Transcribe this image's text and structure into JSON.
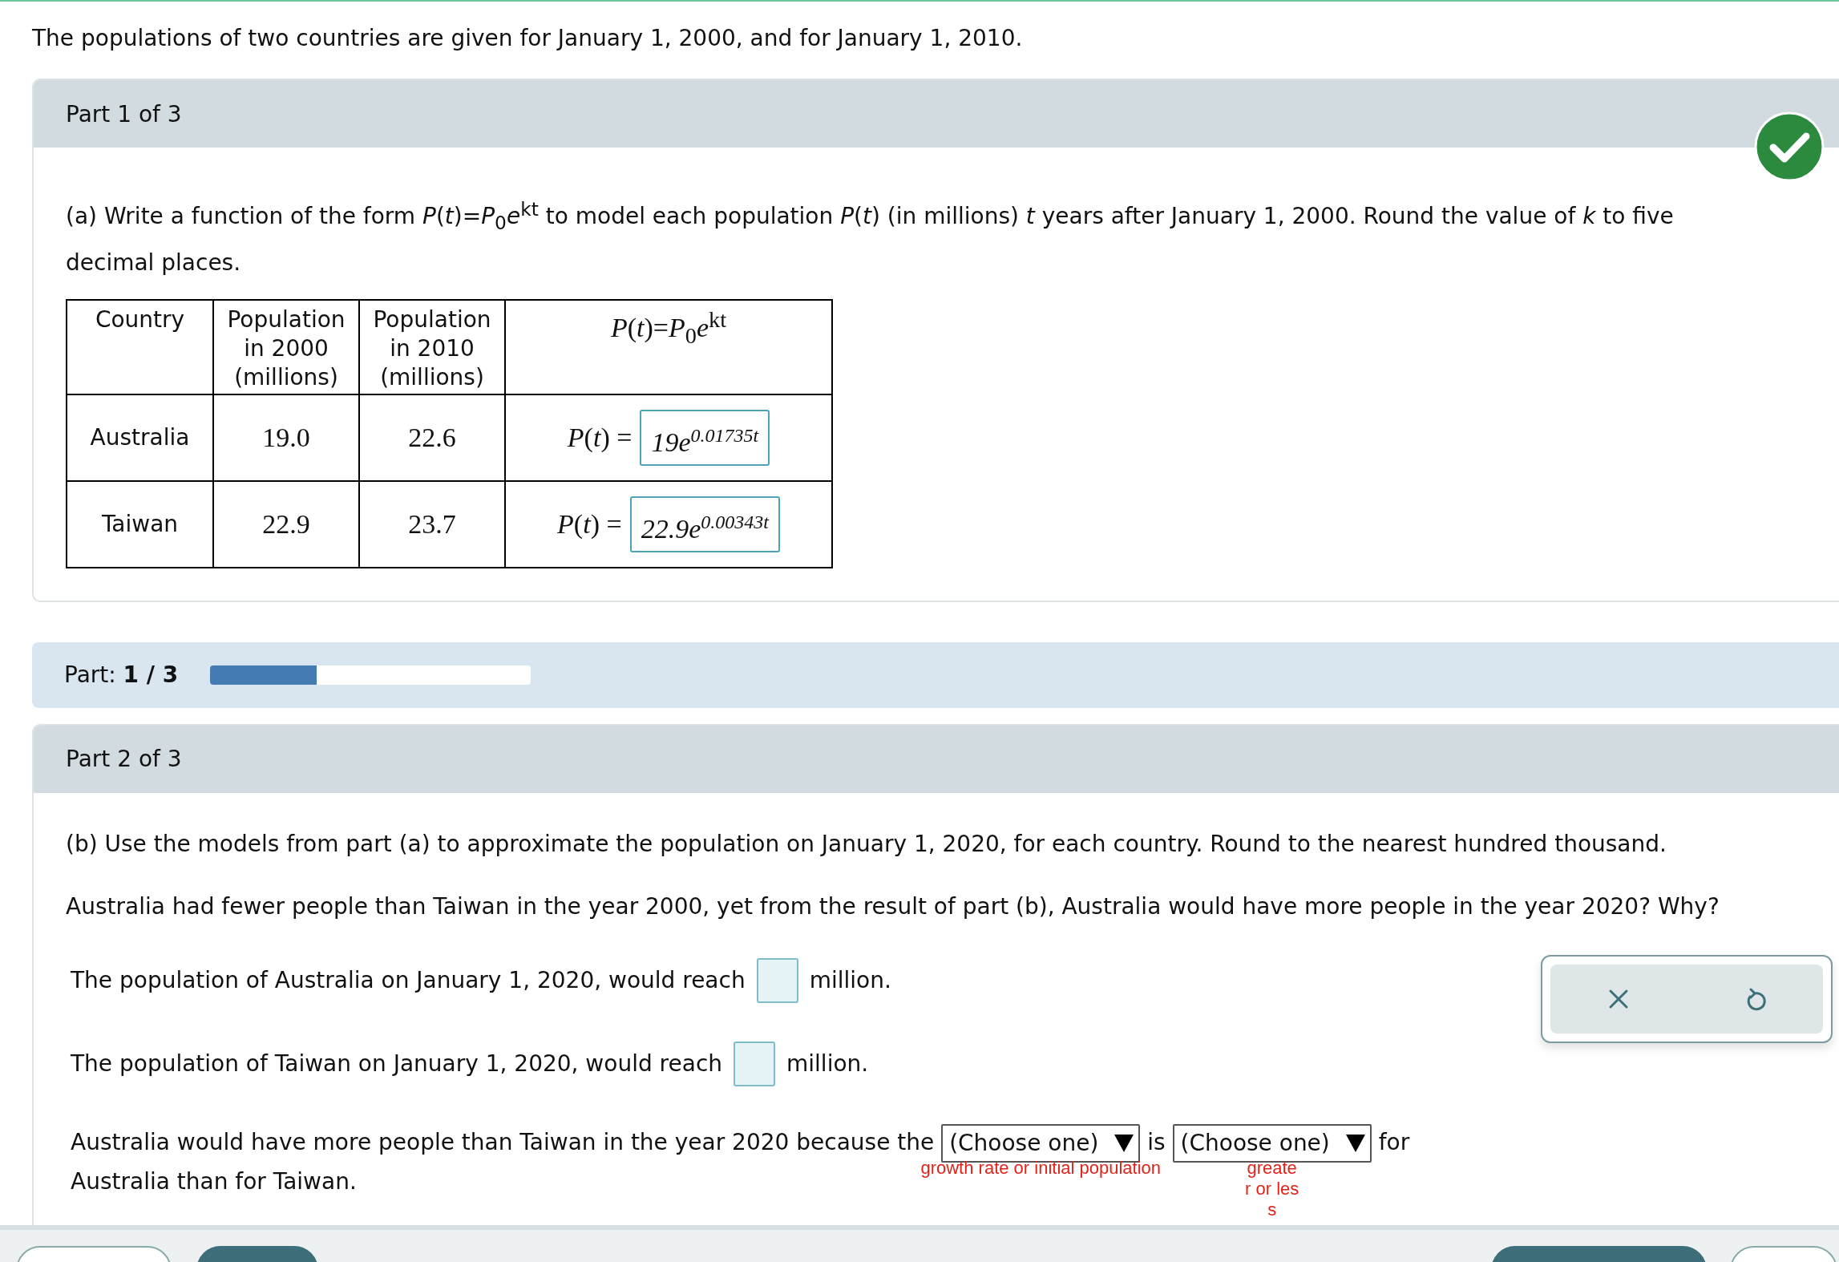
{
  "intro": "The populations of two countries are given for January 1, 2000, and for January 1, 2010.",
  "part1": {
    "header": "Part 1 of 3",
    "correct": true,
    "prompt": "(a) Write a function of the form *P*(*t*)=*P*$_{0}$*e*$^{kt}$ to model each population *P*(*t*) (in millions) *t* years after January 1, 2000. Round the value of *k* to five decimal places.",
    "table": {
      "columns": [
        "Country",
        "Population in 2000 (millions)",
        "Population in 2010 (millions)",
        "*P*(*t*)=*P*$_{0}$*e*$^{kt}$"
      ],
      "rows": [
        {
          "country": "Australia",
          "pop_2000": "19.0",
          "pop_2010": "22.6",
          "lhs": "*P*(*t*) =",
          "answer_base": "19e",
          "answer_exponent": "0.01735t"
        },
        {
          "country": "Taiwan",
          "pop_2000": "22.9",
          "pop_2010": "23.7",
          "lhs": "*P*(*t*) =",
          "answer_base": "22.9e",
          "answer_exponent": "0.00343t"
        }
      ]
    }
  },
  "progress": {
    "label": "Part:",
    "value": "1 / 3",
    "level": 0.333
  },
  "part2": {
    "header": "Part 2 of 3",
    "paragraphs": [
      "(b) Use the models from part (a) to approximate the population on January 1, 2020, for each country. Round to the nearest hundred thousand.",
      "Australia had fewer people than Taiwan in the year 2000, yet from the result of part (b), Australia would have more people in the year 2020? Why?"
    ],
    "answer_lines": [
      {
        "before": "The population of Australia on January 1, 2020, would reach",
        "after": "million."
      },
      {
        "before": "The population of Taiwan on January 1, 2020, would reach",
        "after": "million."
      }
    ],
    "choice_sentence": {
      "before": "Australia would have more people than Taiwan in the year 2020 because the",
      "dropdowns": [
        {
          "value": "(Choose one)",
          "hint": "growth rate or initial population",
          "kind": "inline"
        },
        {
          "value": "(Choose one)",
          "hint": "greater or less",
          "kind": "stacked"
        }
      ],
      "middle": "is",
      "after": "for",
      "line2": "Australia than for Taiwan."
    }
  }
}
